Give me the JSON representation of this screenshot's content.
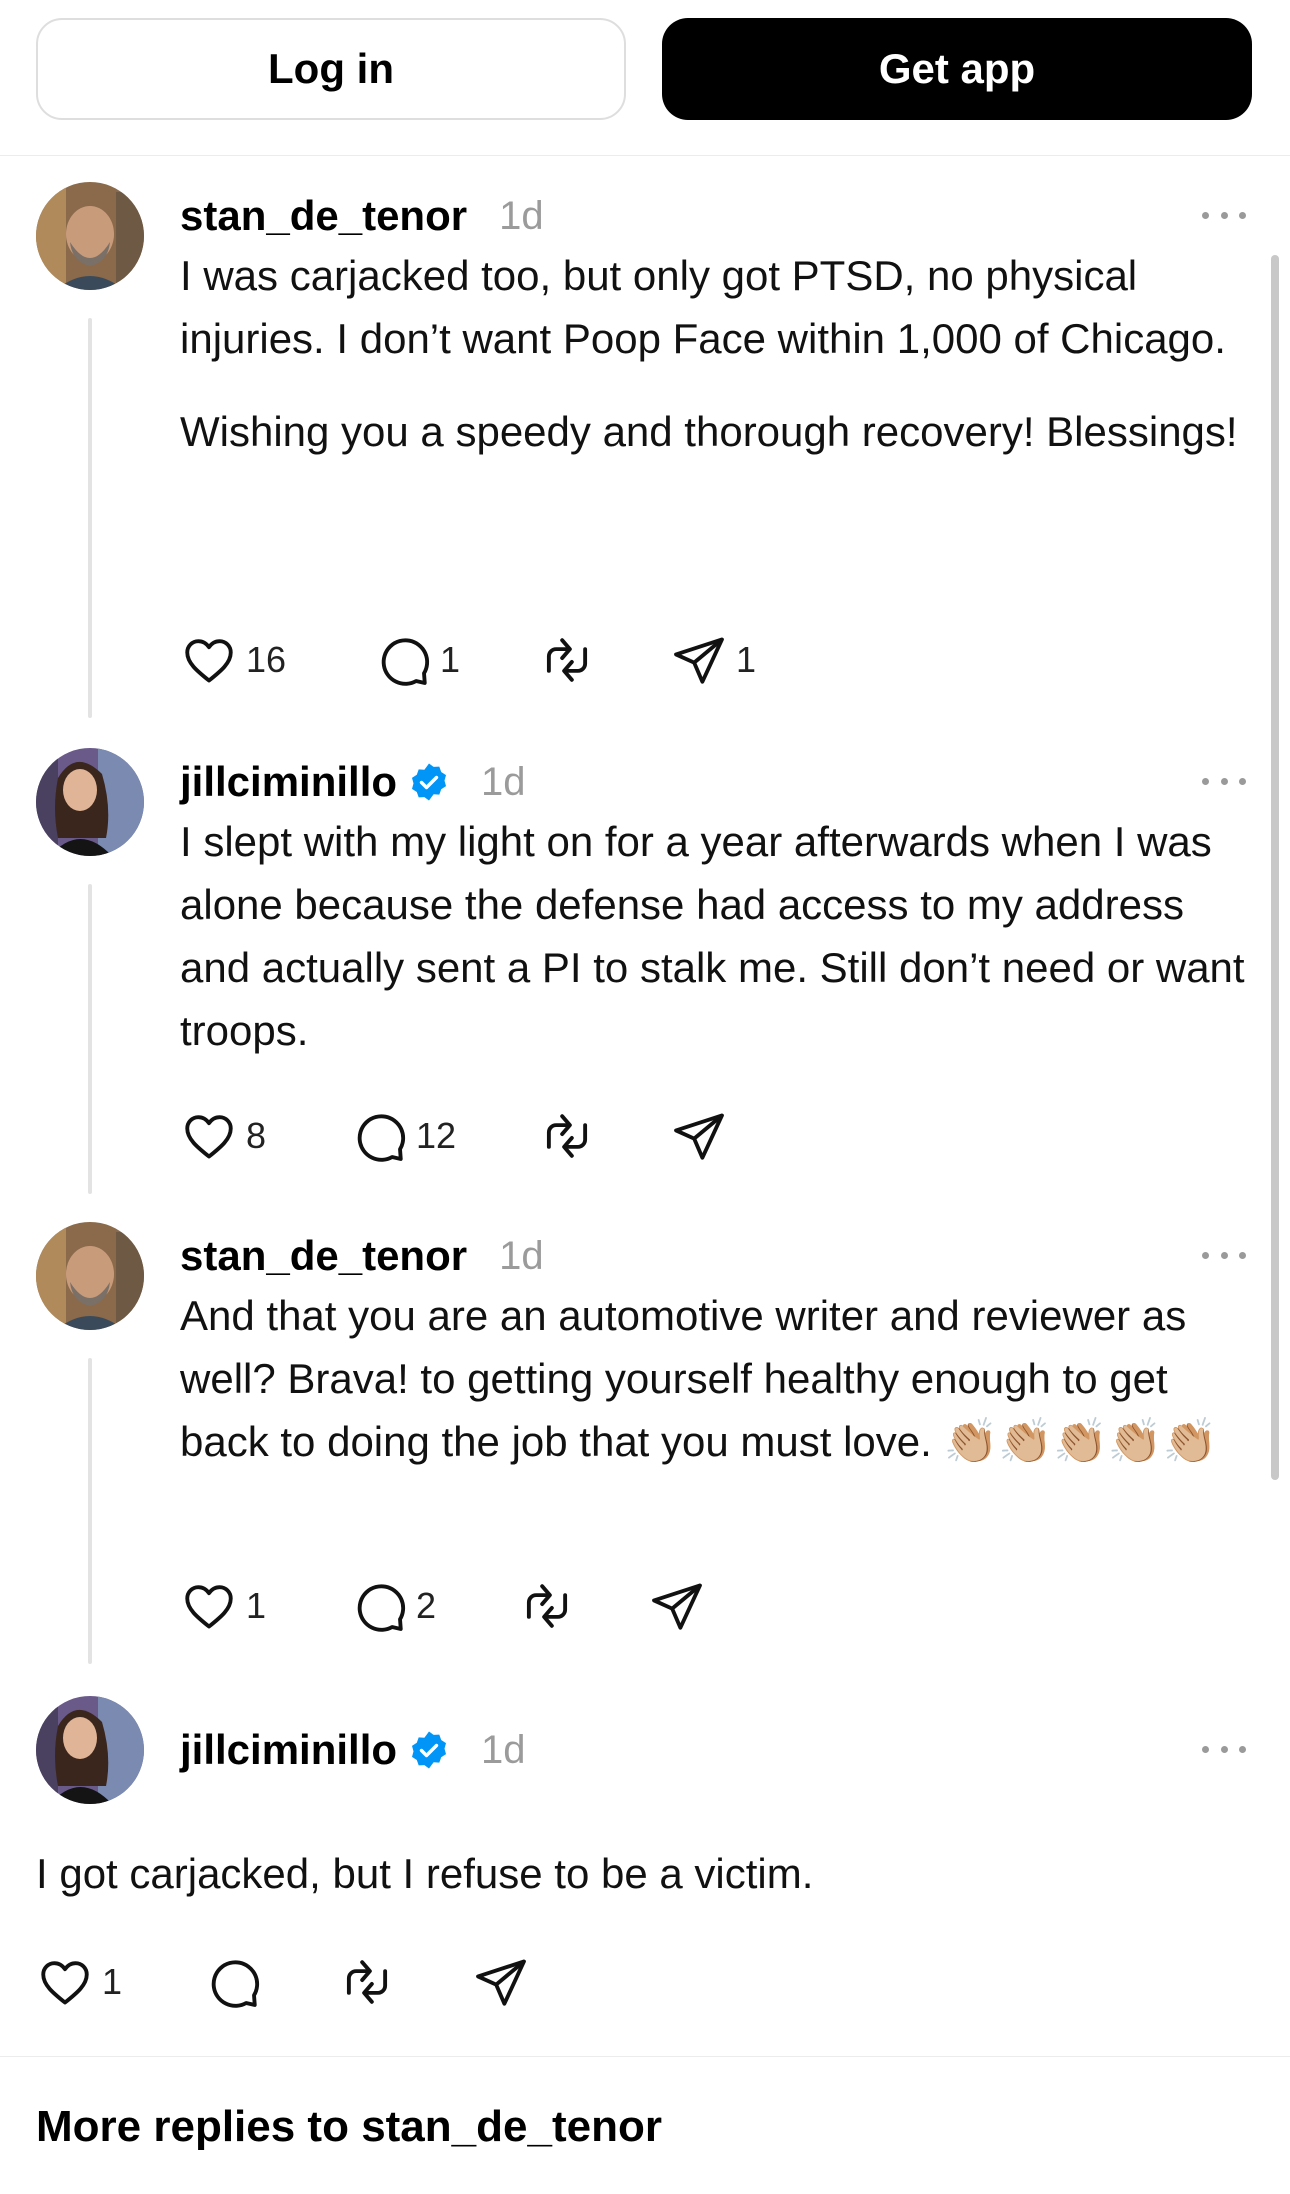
{
  "header": {
    "login_label": "Log in",
    "get_app_label": "Get app"
  },
  "posts": [
    {
      "username": "stan_de_tenor",
      "verified": false,
      "time": "1d",
      "paragraphs": [
        "I was carjacked too, but only got PTSD, no physical injuries. I don’t want Poop Face within 1,000 of Chicago.",
        "Wishing you a speedy and thorough recovery! Blessings!"
      ],
      "likes": "16",
      "replies": "1",
      "reposts": "",
      "shares": "1"
    },
    {
      "username": "jillciminillo",
      "verified": true,
      "time": "1d",
      "paragraphs": [
        "I slept with my light on for a year afterwards when I was alone because the defense had access to my address and actually sent a PI to stalk me. Still don’t need or want troops."
      ],
      "likes": "8",
      "replies": "12",
      "reposts": "",
      "shares": ""
    },
    {
      "username": "stan_de_tenor",
      "verified": false,
      "time": "1d",
      "paragraphs": [
        "And that you are an automotive writer and reviewer as well? Brava! to getting yourself healthy enough to get back to doing the job that you must love."
      ],
      "emoji": "👏🏼👏🏼👏🏼👏🏼👏🏼",
      "likes": "1",
      "replies": "2",
      "reposts": "",
      "shares": ""
    },
    {
      "username": "jillciminillo",
      "verified": true,
      "time": "1d",
      "paragraphs": [
        "I got carjacked, but I refuse to be a victim."
      ],
      "likes": "1",
      "replies": "",
      "reposts": "",
      "shares": ""
    }
  ],
  "more_replies_title": "More replies to stan_de_tenor",
  "colors": {
    "verified_blue": "#0095F6",
    "timestamp_gray": "#9B9B9B"
  },
  "icons": [
    "heart-icon",
    "comment-icon",
    "repost-icon",
    "send-icon",
    "more-icon",
    "verified-icon"
  ]
}
